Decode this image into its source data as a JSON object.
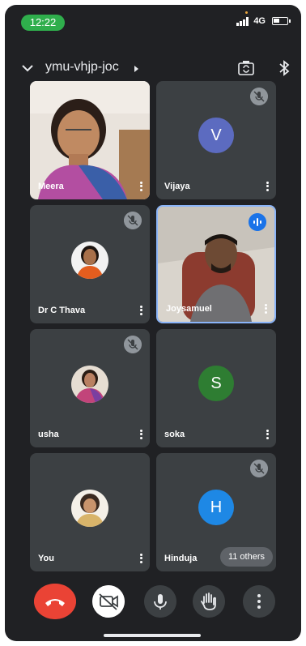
{
  "status_bar": {
    "time": "12:22",
    "network": "4G"
  },
  "header": {
    "meeting_code": "ymu-vhjp-joc"
  },
  "participants": [
    {
      "name": "Meera",
      "type": "video",
      "muted": false
    },
    {
      "name": "Vijaya",
      "type": "letter",
      "initial": "V",
      "color": "#5c6bc0",
      "muted": true
    },
    {
      "name": "Dr C Thava",
      "type": "photo",
      "muted": true
    },
    {
      "name": "Joysamuel",
      "type": "video",
      "muted": false,
      "speaking": true
    },
    {
      "name": "usha",
      "type": "photo",
      "muted": true
    },
    {
      "name": "soka",
      "type": "letter",
      "initial": "S",
      "color": "#2e7d32",
      "muted": false
    },
    {
      "name": "You",
      "type": "photo",
      "muted": false
    },
    {
      "name": "Hinduja",
      "type": "letter",
      "initial": "H",
      "color": "#1e88e5",
      "muted": true
    }
  ],
  "others_count_label": "11 others",
  "controls": {
    "end_call_icon": "end-call-icon",
    "camera_icon": "camera-off-icon",
    "mic_icon": "mic-icon",
    "hand_icon": "raise-hand-icon",
    "more_icon": "more-vert-icon"
  },
  "colors": {
    "background": "#202124",
    "tile": "#3c4043",
    "end_call": "#ea4335",
    "active_border": "#8ab4f8",
    "status_pill": "#2fae4c"
  }
}
